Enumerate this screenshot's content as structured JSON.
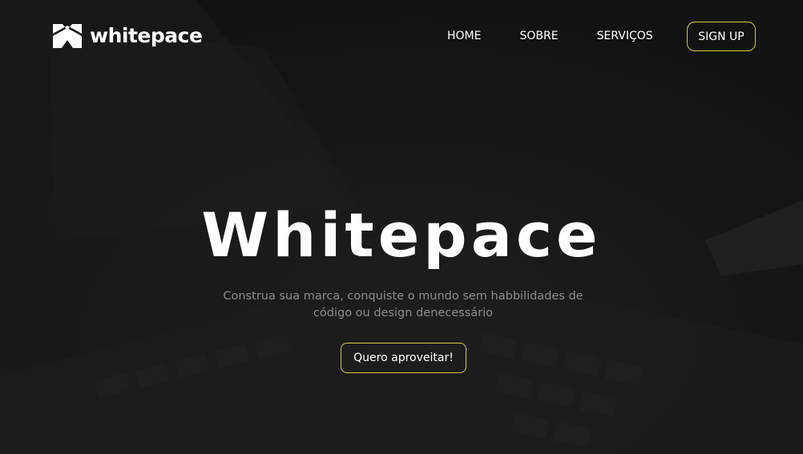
{
  "header": {
    "logo_text": "whitepace",
    "logo_icon": "whitepace-logo-icon",
    "nav": [
      {
        "label": "HOME"
      },
      {
        "label": "SOBRE"
      },
      {
        "label": "SERVIÇOS"
      }
    ],
    "signup_label": "SIGN UP"
  },
  "hero": {
    "title": "Whitepace",
    "subtitle": "Construa sua marca, conquiste o mundo sem habbilidades de código ou design denecessário",
    "cta_label": "Quero aproveitar!",
    "background": "laptop-keyboard-photo"
  },
  "colors": {
    "background": "#161616",
    "accent_border": "#d8c93a",
    "text_primary": "#ffffff",
    "text_muted": "#8c8c8c"
  }
}
